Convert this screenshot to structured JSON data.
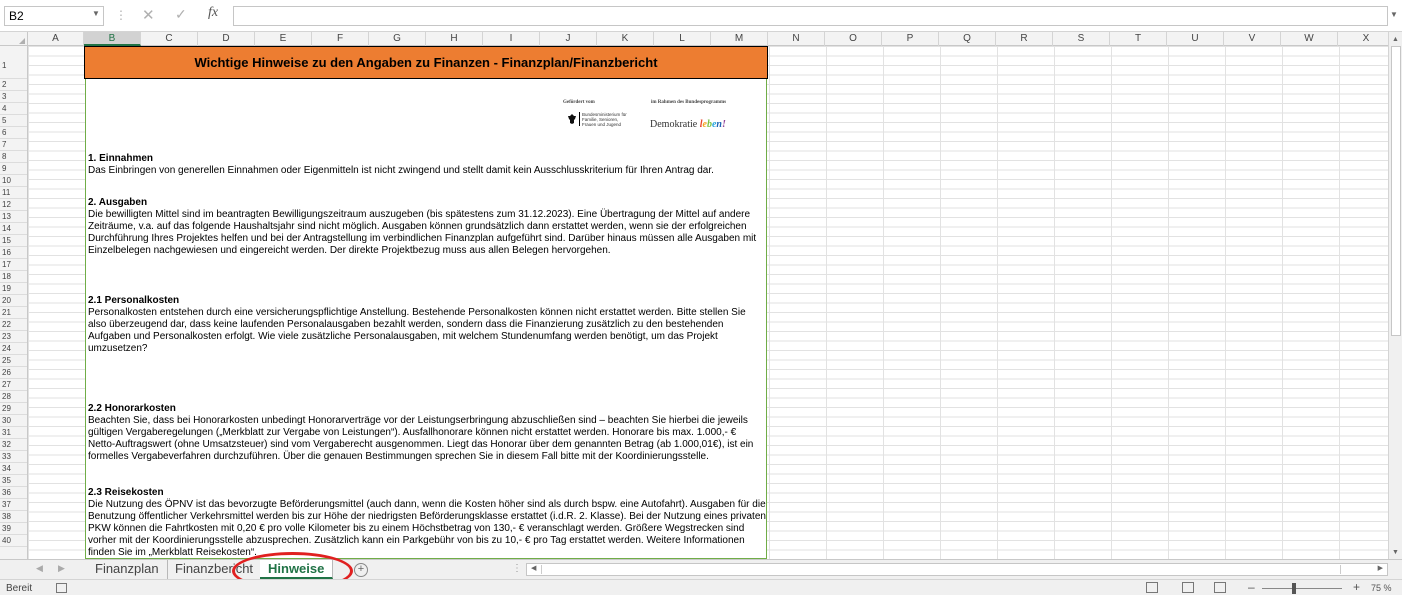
{
  "formula_bar": {
    "name_box": "B2",
    "fx_label": "fx",
    "formula_value": ""
  },
  "columns": [
    "A",
    "B",
    "C",
    "D",
    "E",
    "F",
    "G",
    "H",
    "I",
    "J",
    "K",
    "L",
    "M",
    "N",
    "O",
    "P",
    "Q",
    "R",
    "S",
    "T",
    "U",
    "V",
    "W",
    "X"
  ],
  "rows": [
    "1",
    "2",
    "3",
    "4",
    "5",
    "6",
    "7",
    "8",
    "9",
    "10",
    "11",
    "12",
    "13",
    "14",
    "15",
    "16",
    "17",
    "18",
    "19",
    "20",
    "21",
    "22",
    "23",
    "24",
    "25",
    "26",
    "27",
    "28",
    "29",
    "30",
    "31",
    "32",
    "33",
    "34",
    "35",
    "36",
    "37",
    "38",
    "39",
    "40"
  ],
  "sheet": {
    "title": "Wichtige Hinweise zu den Angaben zu Finanzen - Finanzplan/Finanzbericht",
    "logos": {
      "funded_by": "Gefördert vom",
      "program_label": "im Rahmen des Bundesprogramms",
      "ministry": "Bundesministerium für Familie, Senioren, Frauen und Jugend",
      "program_name": "Demokratie",
      "program_name_accent": "leben!"
    },
    "sections": [
      {
        "heading": "1. Einnahmen",
        "text": "Das Einbringen von generellen Einnahmen oder Eigenmitteln ist nicht zwingend und stellt damit kein Ausschlusskriterium für Ihren Antrag dar."
      },
      {
        "heading": "2. Ausgaben",
        "text": "Die bewilligten Mittel sind im beantragten Bewilligungszeitraum auszugeben (bis spätestens zum 31.12.2023). Eine Übertragung der Mittel auf andere Zeiträume, v.a. auf das folgende Haushaltsjahr sind nicht möglich. Ausgaben können grundsätzlich dann erstattet werden, wenn sie der erfolgreichen Durchführung Ihres Projektes helfen und bei der Antragstellung im verbindlichen Finanzplan aufgeführt sind. Darüber hinaus müssen alle Ausgaben mit Einzelbelegen nachgewiesen und eingereicht werden. Der direkte Projektbezug muss aus allen Belegen hervorgehen."
      },
      {
        "heading": "2.1 Personalkosten",
        "text": "Personalkosten entstehen durch eine versicherungspflichtige Anstellung. Bestehende Personalkosten können nicht erstattet werden. Bitte stellen Sie also überzeugend dar, dass keine laufenden Personalausgaben bezahlt werden, sondern dass die Finanzierung zusätzlich zu den bestehenden Aufgaben und Personalkosten erfolgt. Wie viele zusätzliche Personalausgaben, mit welchem Stundenumfang werden benötigt, um das Projekt umzusetzen?"
      },
      {
        "heading": "2.2 Honorarkosten",
        "text": "Beachten Sie, dass bei Honorarkosten unbedingt Honorarverträge vor der Leistungserbringung abzuschließen sind – beachten Sie hierbei die jeweils gültigen Vergaberegelungen („Merkblatt zur Vergabe von Leistungen“). Ausfallhonorare können nicht erstattet werden. Honorare bis max. 1.000,- € Netto-Auftragswert (ohne Umsatzsteuer) sind vom Vergaberecht ausgenommen. Liegt das Honorar über dem genannten Betrag (ab 1.000,01€), ist ein formelles Vergabeverfahren durchzuführen. Über die genauen Bestimmungen sprechen Sie in diesem Fall bitte mit der Koordinierungsstelle."
      },
      {
        "heading": "2.3 Reisekosten",
        "text": "Die Nutzung des ÖPNV ist das bevorzugte Beförderungsmittel (auch dann, wenn die Kosten höher sind als durch bspw. eine Autofahrt). Ausgaben für die Benutzung öffentlicher Verkehrsmittel werden bis zur Höhe der niedrigsten Beförderungsklasse erstattet (i.d.R. 2. Klasse). Bei der Nutzung eines privaten PKW können die Fahrtkosten mit 0,20 € pro volle Kilometer bis zu einem Höchstbetrag von 130,- € veranschlagt werden. Größere Wegstrecken sind vorher mit der Koordinierungsstelle abzusprechen. Zusätzlich kann ein Parkgebühr von bis zu 10,- € pro Tag erstattet werden. Weitere Informationen finden Sie im „Merkblatt Reisekosten“."
      }
    ]
  },
  "tabs": [
    {
      "label": "Finanzplan",
      "active": false
    },
    {
      "label": "Finanzbericht",
      "active": false
    },
    {
      "label": "Hinweise",
      "active": true
    }
  ],
  "status": {
    "ready_text": "Bereit",
    "zoom": "75 %",
    "zoom_minus": "–",
    "zoom_plus": "+"
  },
  "colors": {
    "title_fill": "#ed7d31",
    "content_border": "#70ad47",
    "active_tab": "#217346",
    "highlight": "#e02020"
  }
}
